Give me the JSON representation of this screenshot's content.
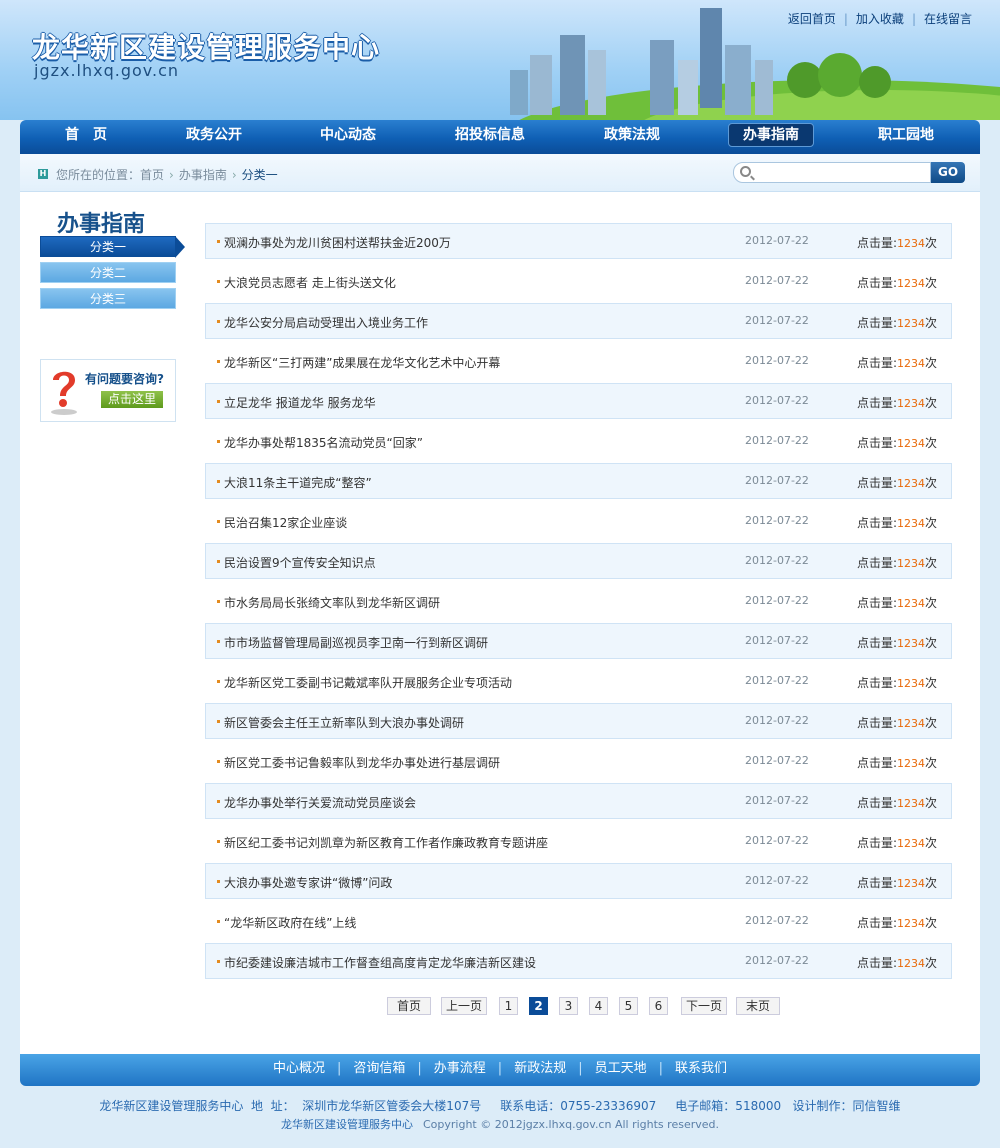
{
  "header": {
    "site_title": "龙华新区建设管理服务中心",
    "site_url": "jgzx.lhxq.gov.cn",
    "top_links": [
      "返回首页",
      "加入收藏",
      "在线留言"
    ]
  },
  "nav": {
    "items": [
      "首　页",
      "政务公开",
      "中心动态",
      "招投标信息",
      "政策法规",
      "办事指南",
      "职工园地"
    ],
    "active_index": 5
  },
  "breadcrumb": {
    "icon": "H",
    "prefix": "您所在的位置：",
    "items": [
      "首页",
      "办事指南",
      "分类一"
    ]
  },
  "search": {
    "placeholder": "",
    "button": "GO"
  },
  "sidebar": {
    "title": "办事指南",
    "items": [
      "分类一",
      "分类二",
      "分类三"
    ],
    "active_index": 0,
    "consult": {
      "text": "有问题要咨询?",
      "button": "点击这里"
    }
  },
  "articles": [
    {
      "title": "观澜办事处为龙川贫困村送帮扶金近200万",
      "date": "2012-07-22",
      "hits_label": "点击量:",
      "hits": "1234",
      "unit": "次"
    },
    {
      "title": "大浪党员志愿者 走上街头送文化",
      "date": "2012-07-22",
      "hits_label": "点击量:",
      "hits": "1234",
      "unit": "次"
    },
    {
      "title": "龙华公安分局启动受理出入境业务工作",
      "date": "2012-07-22",
      "hits_label": "点击量:",
      "hits": "1234",
      "unit": "次"
    },
    {
      "title": "龙华新区“三打两建”成果展在龙华文化艺术中心开幕",
      "date": "2012-07-22",
      "hits_label": "点击量:",
      "hits": "1234",
      "unit": "次"
    },
    {
      "title": "立足龙华 报道龙华 服务龙华",
      "date": "2012-07-22",
      "hits_label": "点击量:",
      "hits": "1234",
      "unit": "次"
    },
    {
      "title": "龙华办事处帮1835名流动党员“回家”",
      "date": "2012-07-22",
      "hits_label": "点击量:",
      "hits": "1234",
      "unit": "次"
    },
    {
      "title": "大浪11条主干道完成“整容”",
      "date": "2012-07-22",
      "hits_label": "点击量:",
      "hits": "1234",
      "unit": "次"
    },
    {
      "title": "民治召集12家企业座谈",
      "date": "2012-07-22",
      "hits_label": "点击量:",
      "hits": "1234",
      "unit": "次"
    },
    {
      "title": "民治设置9个宣传安全知识点",
      "date": "2012-07-22",
      "hits_label": "点击量:",
      "hits": "1234",
      "unit": "次"
    },
    {
      "title": "市水务局局长张绮文率队到龙华新区调研",
      "date": "2012-07-22",
      "hits_label": "点击量:",
      "hits": "1234",
      "unit": "次"
    },
    {
      "title": "市市场监督管理局副巡视员李卫南一行到新区调研",
      "date": "2012-07-22",
      "hits_label": "点击量:",
      "hits": "1234",
      "unit": "次"
    },
    {
      "title": "龙华新区党工委副书记戴斌率队开展服务企业专项活动",
      "date": "2012-07-22",
      "hits_label": "点击量:",
      "hits": "1234",
      "unit": "次"
    },
    {
      "title": "新区管委会主任王立新率队到大浪办事处调研",
      "date": "2012-07-22",
      "hits_label": "点击量:",
      "hits": "1234",
      "unit": "次"
    },
    {
      "title": "新区党工委书记鲁毅率队到龙华办事处进行基层调研",
      "date": "2012-07-22",
      "hits_label": "点击量:",
      "hits": "1234",
      "unit": "次"
    },
    {
      "title": "龙华办事处举行关爱流动党员座谈会",
      "date": "2012-07-22",
      "hits_label": "点击量:",
      "hits": "1234",
      "unit": "次"
    },
    {
      "title": "新区纪工委书记刘凯章为新区教育工作者作廉政教育专题讲座",
      "date": "2012-07-22",
      "hits_label": "点击量:",
      "hits": "1234",
      "unit": "次"
    },
    {
      "title": "大浪办事处邀专家讲“微博”问政",
      "date": "2012-07-22",
      "hits_label": "点击量:",
      "hits": "1234",
      "unit": "次"
    },
    {
      "title": "“龙华新区政府在线”上线",
      "date": "2012-07-22",
      "hits_label": "点击量:",
      "hits": "1234",
      "unit": "次"
    },
    {
      "title": "市纪委建设廉洁城市工作督查组高度肯定龙华廉洁新区建设",
      "date": "2012-07-22",
      "hits_label": "点击量:",
      "hits": "1234",
      "unit": "次"
    }
  ],
  "pager": {
    "first": "首页",
    "prev": "上一页",
    "pages": [
      "1",
      "2",
      "3",
      "4",
      "5",
      "6"
    ],
    "current_index": 1,
    "next": "下一页",
    "last": "末页"
  },
  "footer": {
    "nav": [
      "中心概况",
      "咨询信箱",
      "办事流程",
      "新政法规",
      "员工天地",
      "联系我们"
    ],
    "line1": "龙华新区建设管理服务中心  地  址：  深圳市龙华新区管委会大楼107号     联系电话：0755-23336907     电子邮箱：518000   设计制作：同信智维",
    "line2_name": "龙华新区建设管理服务中心",
    "line2_copyright": "Copyright © 2012jgzx.lhxq.gov.cn All rights reserved."
  },
  "colors": {
    "nav_bg": "#0f5fb4",
    "accent_orange": "#e86a0a",
    "link_blue": "#17518b"
  }
}
